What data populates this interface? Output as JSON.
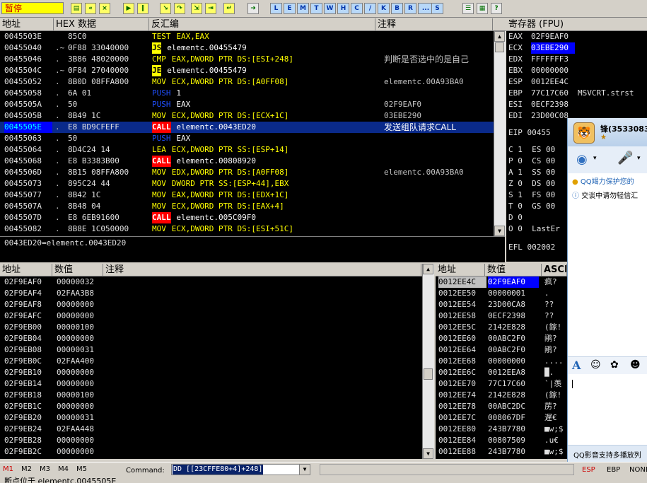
{
  "toolbar": {
    "status": "暂停",
    "letters": [
      "L",
      "E",
      "M",
      "T",
      "W",
      "H",
      "C",
      "/",
      "K",
      "B",
      "R",
      "...",
      "S"
    ]
  },
  "disasm": {
    "headers": [
      "地址",
      "HEX 数据",
      "反汇编",
      "注释"
    ],
    "rows": [
      {
        "addr": "0045503E",
        "mark": " ",
        "hex": "85C0",
        "op": "TEST",
        "args": "EAX,EAX",
        "comment": "",
        "opstyle": "test"
      },
      {
        "addr": "00455040",
        "mark": ".~",
        "hex": "0F88 33040000",
        "op": "JS",
        "args": "elementc.00455479",
        "comment": "",
        "opstyle": "jmp"
      },
      {
        "addr": "00455046",
        "mark": ".",
        "hex": "3B86 48020000",
        "op": "CMP",
        "args": "EAX,DWORD PTR DS:[ESI+248]",
        "comment": "判断是否选中的是自己",
        "opstyle": "mov"
      },
      {
        "addr": "0045504C",
        "mark": ".~",
        "hex": "0F84 27040000",
        "op": "JE",
        "args": "elementc.00455479",
        "comment": "",
        "opstyle": "jmp"
      },
      {
        "addr": "00455052",
        "mark": ".",
        "hex": "8B0D 08FFA800",
        "op": "MOV",
        "args": "ECX,DWORD PTR DS:[A0FF08]",
        "comment": "elementc.00A93BA0",
        "opstyle": "mov"
      },
      {
        "addr": "00455058",
        "mark": ".",
        "hex": "6A 01",
        "op": "PUSH",
        "args": "1",
        "comment": "",
        "opstyle": "push"
      },
      {
        "addr": "0045505A",
        "mark": ".",
        "hex": "50",
        "op": "PUSH",
        "args": "EAX",
        "comment": "02F9EAF0",
        "opstyle": "push"
      },
      {
        "addr": "0045505B",
        "mark": ".",
        "hex": "8B49 1C",
        "op": "MOV",
        "args": "ECX,DWORD PTR DS:[ECX+1C]",
        "comment": "03EBE290",
        "opstyle": "mov"
      },
      {
        "addr": "0045505E",
        "mark": ".",
        "hex": "E8 BD9CFEFF",
        "op": "CALL",
        "args": "elementc.0043ED20",
        "comment": "发送组队请求CALL",
        "opstyle": "call",
        "selected": true
      },
      {
        "addr": "00455063",
        "mark": ".",
        "hex": "50",
        "op": "PUSH",
        "args": "EAX",
        "comment": "",
        "opstyle": "push"
      },
      {
        "addr": "00455064",
        "mark": ".",
        "hex": "8D4C24 14",
        "op": "LEA",
        "args": "ECX,DWORD PTR SS:[ESP+14]",
        "comment": "",
        "opstyle": "mov"
      },
      {
        "addr": "00455068",
        "mark": ".",
        "hex": "E8 B3383B00",
        "op": "CALL",
        "args": "elementc.00808920",
        "comment": "",
        "opstyle": "call"
      },
      {
        "addr": "0045506D",
        "mark": ".",
        "hex": "8B15 08FFA800",
        "op": "MOV",
        "args": "EDX,DWORD PTR DS:[A0FF08]",
        "comment": "elementc.00A93BA0",
        "opstyle": "mov"
      },
      {
        "addr": "00455073",
        "mark": ".",
        "hex": "895C24 44",
        "op": "MOV",
        "args": "DWORD PTR SS:[ESP+44],EBX",
        "comment": "",
        "opstyle": "mov"
      },
      {
        "addr": "00455077",
        "mark": ".",
        "hex": "8B42 1C",
        "op": "MOV",
        "args": "EAX,DWORD PTR DS:[EDX+1C]",
        "comment": "",
        "opstyle": "mov"
      },
      {
        "addr": "0045507A",
        "mark": ".",
        "hex": "8B48 04",
        "op": "MOV",
        "args": "ECX,DWORD PTR DS:[EAX+4]",
        "comment": "",
        "opstyle": "mov"
      },
      {
        "addr": "0045507D",
        "mark": ".",
        "hex": "E8 6EB91600",
        "op": "CALL",
        "args": "elementc.005C09F0",
        "comment": "",
        "opstyle": "call"
      },
      {
        "addr": "00455082",
        "mark": ".",
        "hex": "8B8E 1C050000",
        "op": "MOV",
        "args": "ECX,DWORD PTR DS:[ESI+51C]",
        "comment": "",
        "opstyle": "mov"
      }
    ],
    "info": "0043ED20=elementc.0043ED20"
  },
  "registers": {
    "title": "寄存器 (FPU)",
    "lines": [
      {
        "name": "EAX",
        "value": "02F9EAF0",
        "extra": ""
      },
      {
        "name": "ECX",
        "value": "03EBE290",
        "extra": "",
        "highlight": true
      },
      {
        "name": "EDX",
        "value": "FFFFFFF3",
        "extra": ""
      },
      {
        "name": "EBX",
        "value": "00000000",
        "extra": ""
      },
      {
        "name": "ESP",
        "value": "0012EE4C",
        "extra": ""
      },
      {
        "name": "EBP",
        "value": "77C17C60",
        "extra": "MSVCRT.strst"
      },
      {
        "name": "ESI",
        "value": "0ECF2398",
        "extra": ""
      },
      {
        "name": "EDI",
        "value": "23D00C08",
        "extra": ""
      }
    ],
    "eip": "EIP 00455",
    "flags": [
      "C 1  ES 00",
      "P 0  CS 00",
      "A 1  SS 00",
      "Z 0  DS 00",
      "S 1  FS 00",
      "T 0  GS 00",
      "D 0",
      "O 0  LastEr"
    ],
    "efl": "EFL 002002"
  },
  "dump": {
    "headers": [
      "地址",
      "数值",
      "注释"
    ],
    "rows": [
      [
        "02F9EAF0",
        "00000032"
      ],
      [
        "02F9EAF4",
        "02FAA3B8"
      ],
      [
        "02F9EAF8",
        "00000000"
      ],
      [
        "02F9EAFC",
        "00000000"
      ],
      [
        "02F9EB00",
        "00000100"
      ],
      [
        "02F9EB04",
        "00000000"
      ],
      [
        "02F9EB08",
        "00000031"
      ],
      [
        "02F9EB0C",
        "02FAA400"
      ],
      [
        "02F9EB10",
        "00000000"
      ],
      [
        "02F9EB14",
        "00000000"
      ],
      [
        "02F9EB18",
        "00000100"
      ],
      [
        "02F9EB1C",
        "00000000"
      ],
      [
        "02F9EB20",
        "00000031"
      ],
      [
        "02F9EB24",
        "02FAA448"
      ],
      [
        "02F9EB28",
        "00000000"
      ],
      [
        "02F9EB2C",
        "00000000"
      ]
    ]
  },
  "stack": {
    "headers": [
      "地址",
      "数值",
      "ASCII"
    ],
    "rows": [
      [
        "0012EE4C",
        "02F9EAF0",
        "疯?"
      ],
      [
        "0012EE50",
        "00000001",
        "."
      ],
      [
        "0012EE54",
        "23D00CA8",
        "??"
      ],
      [
        "0012EE58",
        "0ECF2398",
        "??"
      ],
      [
        "0012EE5C",
        "2142E828",
        "(鎵!"
      ],
      [
        "0012EE60",
        "00ABC2F0",
        "鹇?"
      ],
      [
        "0012EE64",
        "00ABC2F0",
        "鹇?"
      ],
      [
        "0012EE68",
        "00000000",
        "...."
      ],
      [
        "0012EE6C",
        "0012EEA8",
        "█."
      ],
      [
        "0012EE70",
        "77C17C60",
        "`|羡"
      ],
      [
        "0012EE74",
        "2142E828",
        "(鎵!"
      ],
      [
        "0012EE78",
        "00ABC2DC",
        "苈?"
      ],
      [
        "0012EE7C",
        "008067DF",
        "遅€"
      ],
      [
        "0012EE80",
        "243B7780",
        "■w;$"
      ],
      [
        "0012EE84",
        "00807509",
        ".u€"
      ],
      [
        "0012EE88",
        "243B7780",
        "■w;$"
      ]
    ]
  },
  "bottom": {
    "tabs": [
      "M1",
      "M2",
      "M3",
      "M4",
      "M5"
    ],
    "command_label": "Command:",
    "command_value": "DD [[23CFFE80+4]+248]",
    "regs": [
      "ESP",
      "EBP",
      "NONE"
    ],
    "status": "断点位于 elementc.0045505E"
  },
  "qq": {
    "name": "锋(3533083",
    "warning": "QQ竭力保护您的",
    "notice": "交谈中请勿轻信汇",
    "footer": "QQ影音支持多播放列",
    "colors": {
      "accent": "#1f63b5"
    }
  }
}
